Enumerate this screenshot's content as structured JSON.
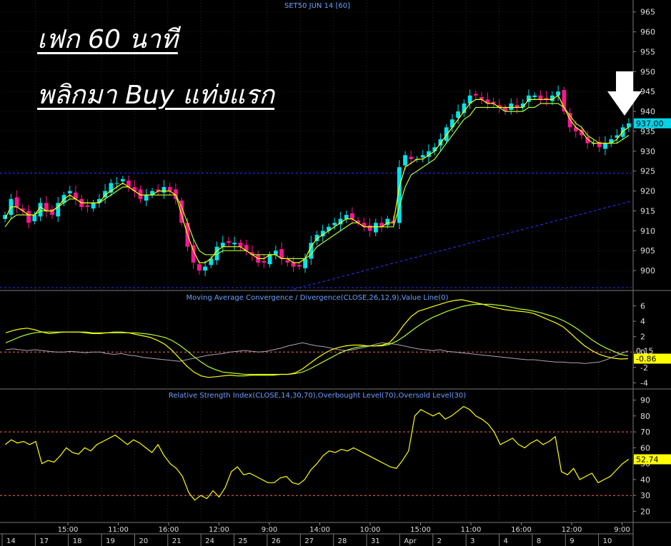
{
  "overlay": {
    "line1": "เฟก 60 นาที",
    "line2": "พลิกมา Buy แท่งแรก"
  },
  "colors": {
    "background": "#000000",
    "up_candle": "#00e5ee",
    "down_candle": "#ff1493",
    "ma_fast": "#ffff00",
    "ma_slow": "#adff2f",
    "macd_line": "#ffff00",
    "signal_line": "#adff2f",
    "value_line": "#b0a0b0",
    "rsi_line": "#ffff00",
    "level_line": "#ff6464",
    "trend_line": "#3030ff",
    "caption": "#6aa0ff",
    "price_tag": "#00d5e8",
    "macd_tag": "#ffff00",
    "rsi_tag": "#ffff00"
  },
  "chart_data": [
    {
      "type": "candlestick",
      "title": "SET50 JUN 14  [60]",
      "ylim": [
        895,
        968
      ],
      "yticks": [
        900,
        905,
        910,
        915,
        920,
        925,
        930,
        935,
        940,
        945,
        950,
        955,
        960,
        965
      ],
      "last_price_label": "937.00",
      "reference_line": 924.5,
      "trend_line": {
        "from": [
          0.455,
          895
        ],
        "to": [
          1.0,
          917.5
        ]
      },
      "close": [
        914,
        918,
        916,
        915,
        912,
        914,
        917,
        915,
        914,
        917,
        919,
        920,
        918,
        916,
        916,
        917,
        918,
        920,
        922,
        922,
        923,
        921,
        920,
        918,
        919,
        920,
        920,
        921,
        920,
        918,
        912,
        906,
        902,
        900,
        901,
        903,
        906,
        907,
        907,
        907,
        906,
        905,
        904,
        902,
        902,
        904,
        905,
        903,
        902,
        901,
        901,
        903,
        907,
        909,
        910,
        911,
        912,
        913,
        914,
        913,
        912,
        911,
        910,
        912,
        911,
        913,
        912,
        926,
        929,
        928,
        928,
        929,
        930,
        931,
        933,
        936,
        938,
        940,
        942,
        944,
        944,
        943,
        942,
        942,
        941,
        940,
        942,
        941,
        942,
        944,
        944,
        943,
        943,
        944,
        945,
        940,
        936,
        935,
        934,
        932,
        932,
        931,
        932,
        933,
        934,
        936,
        937
      ],
      "ma_fast": [
        913,
        916,
        916,
        915,
        914,
        914,
        916,
        915,
        915,
        916,
        918,
        919,
        918,
        917,
        917,
        917,
        917,
        919,
        920,
        921,
        922,
        921,
        920,
        919,
        919,
        919,
        920,
        920,
        920,
        919,
        914,
        909,
        905,
        902,
        902,
        903,
        905,
        906,
        906,
        906,
        906,
        905,
        904,
        903,
        903,
        904,
        904,
        903,
        903,
        902,
        902,
        903,
        906,
        908,
        909,
        910,
        911,
        912,
        913,
        913,
        912,
        911,
        911,
        911,
        911,
        912,
        912,
        921,
        926,
        927,
        928,
        928,
        929,
        930,
        932,
        934,
        936,
        938,
        940,
        942,
        943,
        943,
        942,
        942,
        941,
        941,
        941,
        941,
        941,
        943,
        943,
        943,
        943,
        943,
        944,
        941,
        938,
        936,
        935,
        933,
        932,
        932,
        932,
        932,
        933,
        935,
        936
      ],
      "ma_slow": [
        911,
        913,
        914,
        914,
        914,
        914,
        915,
        915,
        915,
        916,
        917,
        918,
        918,
        917,
        917,
        917,
        917,
        918,
        919,
        920,
        921,
        921,
        920,
        919,
        919,
        919,
        919,
        919,
        919,
        919,
        916,
        912,
        908,
        905,
        904,
        904,
        904,
        905,
        905,
        905,
        905,
        905,
        904,
        904,
        904,
        904,
        904,
        903,
        903,
        903,
        903,
        903,
        904,
        906,
        907,
        908,
        909,
        910,
        911,
        912,
        912,
        911,
        911,
        911,
        911,
        911,
        911,
        916,
        921,
        924,
        925,
        926,
        927,
        928,
        930,
        932,
        934,
        936,
        938,
        939,
        941,
        941,
        941,
        941,
        941,
        940,
        940,
        940,
        940,
        941,
        941,
        942,
        942,
        942,
        942,
        941,
        939,
        937,
        936,
        934,
        933,
        932,
        932,
        932,
        932,
        933,
        934
      ]
    },
    {
      "type": "line",
      "title": "Moving Average Convergence / Divergence(CLOSE,26,12,9),Value Line(0)",
      "ylim": [
        -4.8,
        8.0
      ],
      "yticks": [
        -4,
        -2,
        0,
        2,
        4,
        6
      ],
      "last_macd_label": "-0.86",
      "last_value_label": "0.15",
      "zero_line": 0,
      "macd": [
        2.5,
        2.8,
        3.0,
        3.1,
        2.9,
        2.6,
        2.4,
        2.5,
        2.6,
        2.6,
        2.6,
        2.5,
        2.4,
        2.4,
        2.5,
        2.6,
        2.6,
        2.5,
        2.3,
        2.1,
        1.9,
        1.5,
        1.0,
        0.2,
        -0.8,
        -1.8,
        -2.6,
        -3.1,
        -3.3,
        -3.2,
        -3.1,
        -3.0,
        -3.1,
        -3.1,
        -3.0,
        -3.0,
        -3.0,
        -3.0,
        -2.9,
        -2.9,
        -2.7,
        -2.2,
        -1.5,
        -0.8,
        -0.2,
        0.3,
        0.6,
        0.8,
        0.9,
        0.9,
        0.8,
        0.8,
        0.9,
        1.2,
        2.2,
        3.5,
        4.6,
        5.3,
        5.6,
        5.9,
        6.2,
        6.5,
        6.7,
        6.8,
        6.6,
        6.4,
        6.2,
        5.9,
        5.7,
        5.5,
        5.4,
        5.3,
        5.2,
        5.0,
        4.6,
        4.2,
        3.8,
        3.3,
        2.5,
        1.6,
        0.8,
        0.2,
        -0.3,
        -0.6,
        -0.8,
        -0.9,
        -0.86
      ],
      "signal": [
        1.2,
        1.6,
        2.0,
        2.3,
        2.5,
        2.6,
        2.6,
        2.6,
        2.6,
        2.6,
        2.6,
        2.6,
        2.5,
        2.5,
        2.5,
        2.5,
        2.5,
        2.5,
        2.5,
        2.4,
        2.3,
        2.1,
        1.9,
        1.5,
        0.9,
        0.2,
        -0.6,
        -1.3,
        -1.9,
        -2.3,
        -2.6,
        -2.7,
        -2.8,
        -2.9,
        -2.9,
        -2.9,
        -2.9,
        -2.9,
        -2.9,
        -2.9,
        -2.8,
        -2.6,
        -2.2,
        -1.7,
        -1.2,
        -0.7,
        -0.2,
        0.2,
        0.5,
        0.7,
        0.8,
        0.8,
        0.8,
        1.0,
        1.4,
        2.0,
        2.7,
        3.4,
        4.0,
        4.5,
        4.9,
        5.3,
        5.6,
        5.9,
        6.1,
        6.2,
        6.2,
        6.2,
        6.1,
        6.0,
        5.8,
        5.6,
        5.5,
        5.3,
        5.1,
        4.8,
        4.5,
        4.1,
        3.6,
        3.0,
        2.3,
        1.6,
        1.0,
        0.5,
        0.1,
        -0.3,
        -0.5
      ],
      "value_line": [
        0.3,
        0.4,
        0.3,
        0.2,
        0.3,
        0.2,
        0.1,
        0.0,
        0.0,
        0.1,
        0.0,
        -0.1,
        0.0,
        0.0,
        -0.2,
        -0.3,
        -0.2,
        -0.4,
        -0.5,
        -0.7,
        -0.8,
        -0.9,
        -1.0,
        -1.1,
        -1.2,
        -1.0,
        -0.8,
        -0.6,
        -0.4,
        -0.3,
        -0.2,
        0.0,
        0.1,
        0.2,
        0.1,
        0.0,
        0.1,
        0.3,
        0.5,
        0.8,
        1.0,
        1.2,
        1.0,
        0.8,
        0.7,
        0.5,
        0.3,
        0.2,
        0.3,
        0.5,
        0.7,
        1.0,
        1.2,
        1.1,
        1.0,
        0.8,
        0.6,
        0.4,
        0.3,
        0.2,
        0.3,
        0.1,
        0.0,
        -0.1,
        -0.2,
        -0.3,
        -0.4,
        -0.5,
        -0.6,
        -0.7,
        -0.8,
        -0.9,
        -1.0,
        -1.0,
        -1.1,
        -1.2,
        -1.3,
        -1.3,
        -1.4,
        -1.4,
        -1.5,
        -1.4,
        -1.3,
        -1.0,
        -0.6,
        -0.2,
        0.15
      ]
    },
    {
      "type": "line",
      "title": "Relative Strength Index(CLOSE,14,30,70),Overbought Level(70),Oversold Level(30)",
      "ylim": [
        13,
        97
      ],
      "yticks": [
        20,
        30,
        40,
        50,
        60,
        70,
        80,
        90
      ],
      "last_label": "52.74",
      "overbought": 70,
      "oversold": 30,
      "rsi": [
        62,
        65,
        63,
        64,
        62,
        64,
        50,
        52,
        51,
        55,
        60,
        57,
        56,
        60,
        58,
        62,
        64,
        66,
        68,
        65,
        62,
        65,
        63,
        60,
        57,
        62,
        55,
        50,
        47,
        42,
        32,
        27,
        30,
        28,
        33,
        29,
        35,
        45,
        48,
        43,
        44,
        42,
        40,
        38,
        38,
        41,
        42,
        38,
        37,
        40,
        46,
        50,
        55,
        58,
        57,
        59,
        58,
        60,
        58,
        56,
        54,
        52,
        50,
        48,
        47,
        52,
        58,
        80,
        84,
        82,
        80,
        82,
        78,
        80,
        83,
        86,
        84,
        80,
        78,
        75,
        70,
        62,
        64,
        66,
        62,
        60,
        63,
        65,
        62,
        64,
        67,
        45,
        43,
        47,
        40,
        42,
        44,
        38,
        40,
        42,
        46,
        50,
        52.74
      ],
      "x_tick_labels": [
        "15:00",
        "11:00",
        "16:00",
        "12:00",
        "9:00",
        "14:00",
        "10:00",
        "15:00",
        "11:00",
        "16:00",
        "12:00",
        "9:00"
      ]
    }
  ],
  "date_axis": {
    "labels": [
      "14",
      "17",
      "18",
      "19",
      "20",
      "21",
      "24",
      "25",
      "26",
      "27",
      "28",
      "31",
      "Apr",
      "2",
      "3",
      "4",
      "8",
      "9",
      "10"
    ]
  }
}
